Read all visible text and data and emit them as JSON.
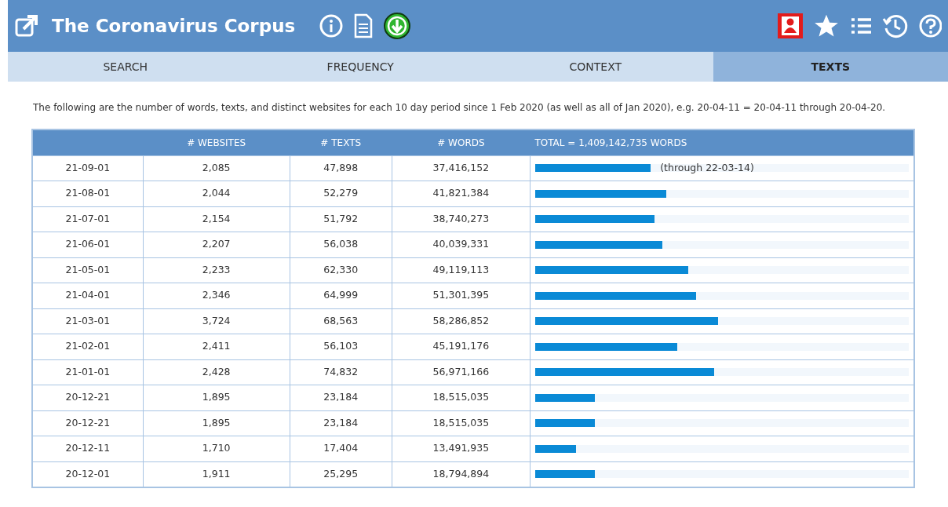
{
  "header": {
    "title": "The Coronavirus Corpus"
  },
  "tabs": [
    {
      "label": "SEARCH",
      "selected": false
    },
    {
      "label": "FREQUENCY",
      "selected": false
    },
    {
      "label": "CONTEXT",
      "selected": false
    },
    {
      "label": "TEXTS",
      "selected": true
    }
  ],
  "intro": "The following are the number of words, texts, and distinct websites for each 10 day period since 1 Feb 2020 (as well as all of Jan 2020), e.g. 20-04-11 = 20-04-11 through 20-04-20.",
  "table": {
    "columns": [
      "# WEBSITES",
      "# TEXTS",
      "# WORDS",
      "TOTAL = 1,409,142,735 WORDS"
    ],
    "rows": [
      {
        "period": "21-09-01",
        "websites": "2,085",
        "texts": "47,898",
        "words": "37,416,152",
        "level": 0.31,
        "note": "(through 22-03-14)"
      },
      {
        "period": "21-08-01",
        "websites": "2,044",
        "texts": "52,279",
        "words": "41,821,384",
        "level": 0.35
      },
      {
        "period": "21-07-01",
        "websites": "2,154",
        "texts": "51,792",
        "words": "38,740,273",
        "level": 0.32
      },
      {
        "period": "21-06-01",
        "websites": "2,207",
        "texts": "56,038",
        "words": "40,039,331",
        "level": 0.34
      },
      {
        "period": "21-05-01",
        "websites": "2,233",
        "texts": "62,330",
        "words": "49,119,113",
        "level": 0.41
      },
      {
        "period": "21-04-01",
        "websites": "2,346",
        "texts": "64,999",
        "words": "51,301,395",
        "level": 0.43
      },
      {
        "period": "21-03-01",
        "websites": "3,724",
        "texts": "68,563",
        "words": "58,286,852",
        "level": 0.49
      },
      {
        "period": "21-02-01",
        "websites": "2,411",
        "texts": "56,103",
        "words": "45,191,176",
        "level": 0.38
      },
      {
        "period": "21-01-01",
        "websites": "2,428",
        "texts": "74,832",
        "words": "56,971,166",
        "level": 0.48
      },
      {
        "period": "20-12-21",
        "websites": "1,895",
        "texts": "23,184",
        "words": "18,515,035",
        "level": 0.16
      },
      {
        "period": "20-12-21",
        "websites": "1,895",
        "texts": "23,184",
        "words": "18,515,035",
        "level": 0.16
      },
      {
        "period": "20-12-11",
        "websites": "1,710",
        "texts": "17,404",
        "words": "13,491,935",
        "level": 0.11
      },
      {
        "period": "20-12-01",
        "websites": "1,911",
        "texts": "25,295",
        "words": "18,794,894",
        "level": 0.16
      }
    ]
  }
}
